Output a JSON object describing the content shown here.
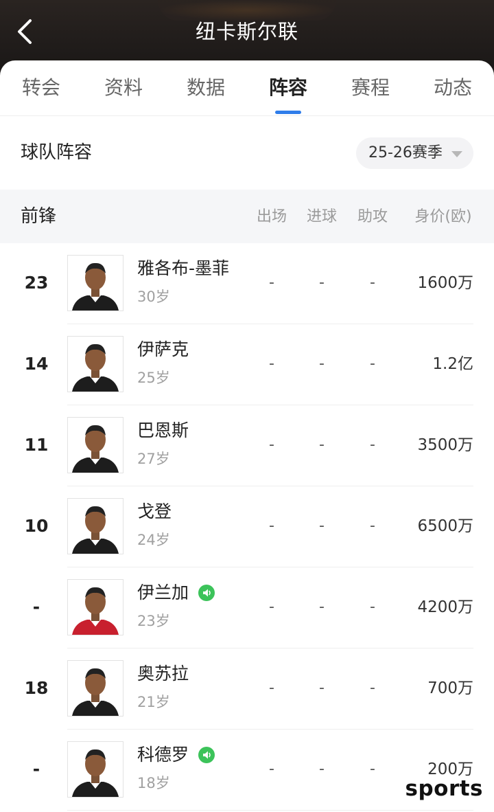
{
  "header": {
    "title": "纽卡斯尔联"
  },
  "tabs": [
    {
      "label": "转会",
      "active": false
    },
    {
      "label": "资料",
      "active": false
    },
    {
      "label": "数据",
      "active": false
    },
    {
      "label": "阵容",
      "active": true
    },
    {
      "label": "赛程",
      "active": false
    },
    {
      "label": "动态",
      "active": false
    }
  ],
  "roster": {
    "title": "球队阵容",
    "season": "25-26赛季"
  },
  "columns": {
    "position": "前锋",
    "appearances": "出场",
    "goals": "进球",
    "assists": "助攻",
    "value": "身价(欧)"
  },
  "players": [
    {
      "number": "23",
      "name": "雅各布-墨菲",
      "age": "30岁",
      "appearances": "-",
      "goals": "-",
      "assists": "-",
      "value": "1600万",
      "voice_icon": false,
      "kit": "black"
    },
    {
      "number": "14",
      "name": "伊萨克",
      "age": "25岁",
      "appearances": "-",
      "goals": "-",
      "assists": "-",
      "value": "1.2亿",
      "voice_icon": false,
      "kit": "black"
    },
    {
      "number": "11",
      "name": "巴恩斯",
      "age": "27岁",
      "appearances": "-",
      "goals": "-",
      "assists": "-",
      "value": "3500万",
      "voice_icon": false,
      "kit": "black"
    },
    {
      "number": "10",
      "name": "戈登",
      "age": "24岁",
      "appearances": "-",
      "goals": "-",
      "assists": "-",
      "value": "6500万",
      "voice_icon": false,
      "kit": "black"
    },
    {
      "number": "-",
      "name": "伊兰加",
      "age": "23岁",
      "appearances": "-",
      "goals": "-",
      "assists": "-",
      "value": "4200万",
      "voice_icon": true,
      "kit": "red"
    },
    {
      "number": "18",
      "name": "奥苏拉",
      "age": "21岁",
      "appearances": "-",
      "goals": "-",
      "assists": "-",
      "value": "700万",
      "voice_icon": false,
      "kit": "black"
    },
    {
      "number": "-",
      "name": "科德罗",
      "age": "18岁",
      "appearances": "-",
      "goals": "-",
      "assists": "-",
      "value": "200万",
      "voice_icon": true,
      "kit": "black"
    }
  ],
  "watermark": "sports",
  "colors": {
    "accent": "#2f7dea",
    "voice_icon": "#3cc35a",
    "header_bg": "#1b1817"
  }
}
